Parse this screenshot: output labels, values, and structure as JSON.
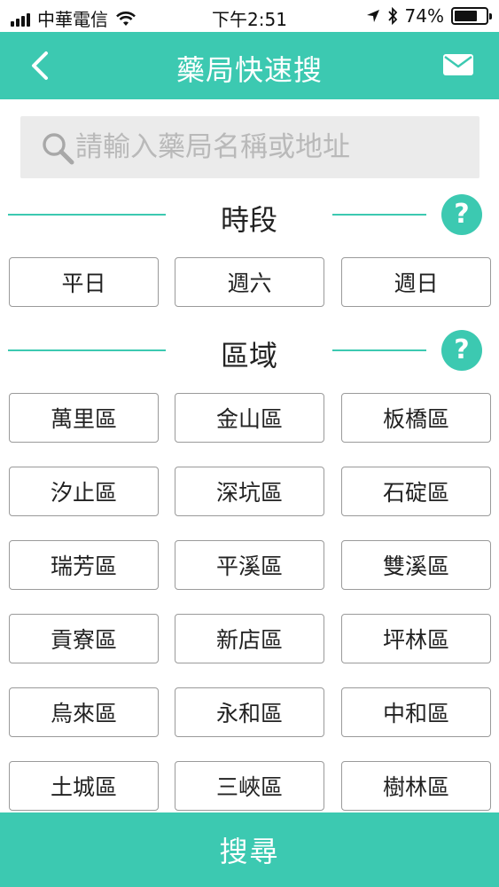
{
  "status_bar": {
    "carrier": "中華電信",
    "time": "下午2:51",
    "battery": "74%",
    "battery_level": 0.74,
    "icons": [
      "signal-icon",
      "wifi-icon",
      "location-arrow-icon",
      "bluetooth-icon",
      "battery-icon"
    ]
  },
  "header": {
    "title": "藥局快速搜",
    "back_icon": "chevron-left-icon",
    "mail_icon": "envelope-icon"
  },
  "search": {
    "placeholder": "請輸入藥局名稱或地址",
    "icon": "search-icon"
  },
  "period": {
    "title": "時段",
    "help": "?",
    "options": [
      "平日",
      "週六",
      "週日"
    ]
  },
  "district": {
    "title": "區域",
    "help": "?",
    "options": [
      "萬里區",
      "金山區",
      "板橋區",
      "汐止區",
      "深坑區",
      "石碇區",
      "瑞芳區",
      "平溪區",
      "雙溪區",
      "貢寮區",
      "新店區",
      "坪林區",
      "烏來區",
      "永和區",
      "中和區",
      "土城區",
      "三峽區",
      "樹林區"
    ]
  },
  "footer": {
    "search_label": "搜尋"
  },
  "colors": {
    "accent": "#3cc9b1",
    "search_bg": "#ebebeb",
    "chip_border": "#9a9a9a"
  }
}
